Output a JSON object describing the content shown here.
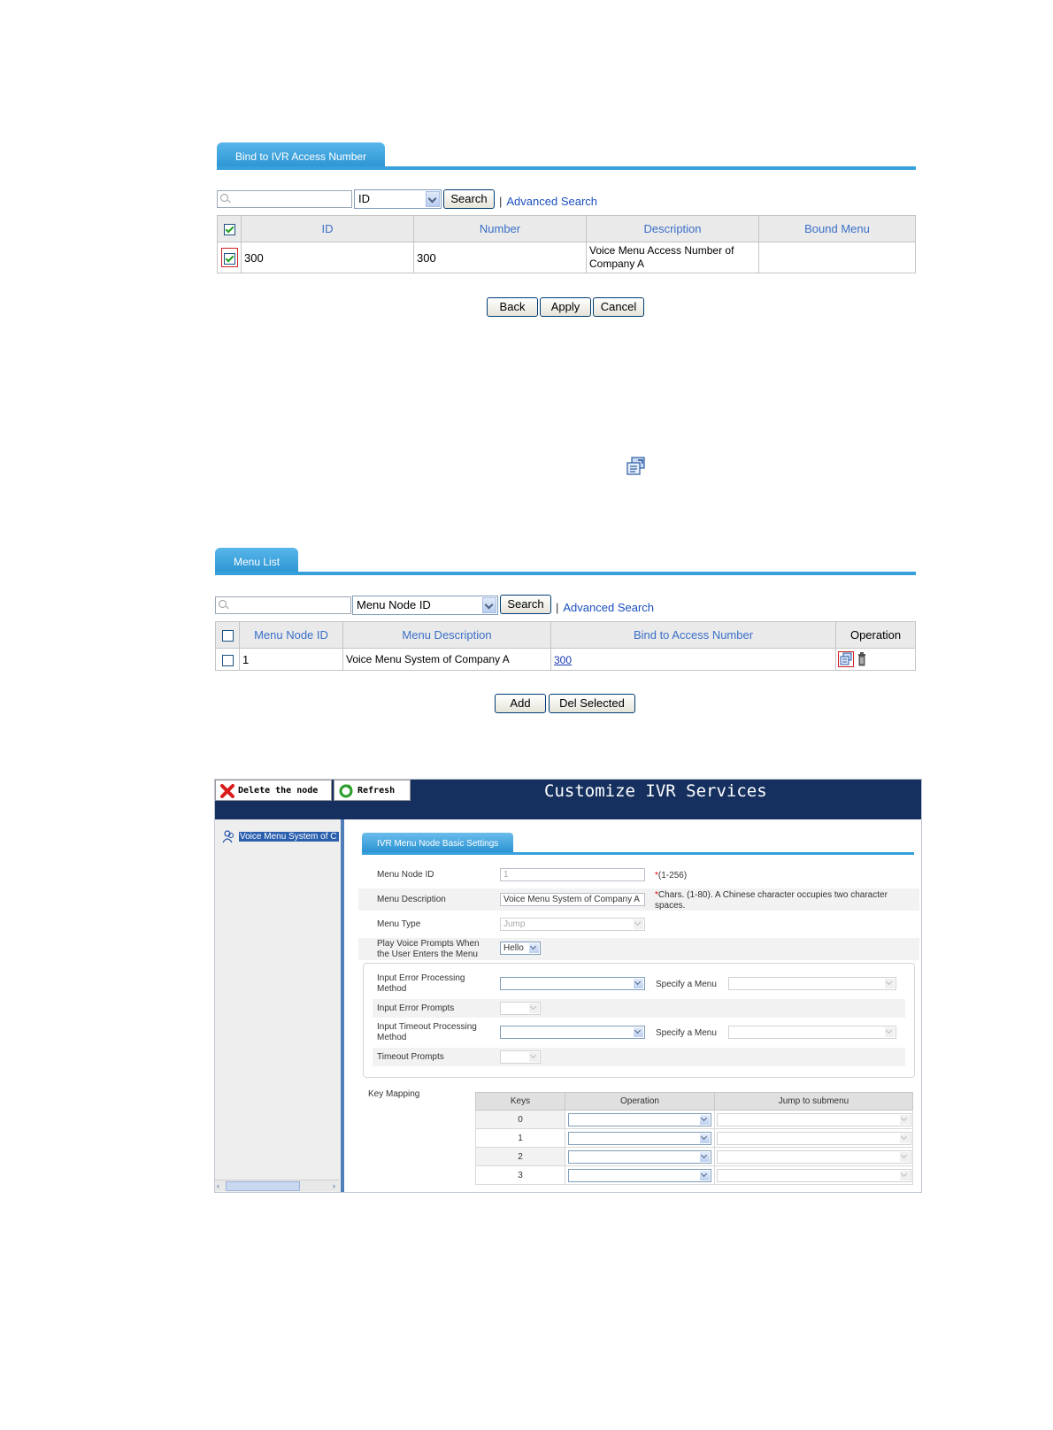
{
  "panel1": {
    "tab": "Bind to IVR Access Number",
    "search": {
      "value": "",
      "field": "ID",
      "button": "Search",
      "advanced": "Advanced Search"
    },
    "columns": [
      "ID",
      "Number",
      "Description",
      "Bound Menu"
    ],
    "rows": [
      {
        "checked": true,
        "id": "300",
        "number": "300",
        "description": "Voice Menu Access Number of Company A",
        "bound_menu": ""
      }
    ],
    "buttons": {
      "back": "Back",
      "apply": "Apply",
      "cancel": "Cancel"
    }
  },
  "icon_standalone": "bind-access-number-icon",
  "panel2": {
    "tab": "Menu List",
    "search": {
      "value": "",
      "field": "Menu Node ID",
      "button": "Search",
      "advanced": "Advanced Search"
    },
    "columns": [
      "Menu Node ID",
      "Menu Description",
      "Bind to Access Number",
      "Operation"
    ],
    "rows": [
      {
        "checked": false,
        "node_id": "1",
        "description": "Voice Menu System of Company A",
        "access_number": "300"
      }
    ],
    "buttons": {
      "add": "Add",
      "del_selected": "Del Selected"
    }
  },
  "ivr": {
    "toolbar": {
      "delete": "Delete the node",
      "refresh": "Refresh"
    },
    "title": "Customize IVR Services",
    "tree_item": "Voice Menu System of C",
    "section_tab": "IVR Menu Node Basic Settings",
    "fields": {
      "menu_node_id": {
        "label": "Menu Node ID",
        "value": "1",
        "note": "(1-256)"
      },
      "menu_description": {
        "label": "Menu Description",
        "value": "Voice Menu System of Company A",
        "note": "Chars. (1-80). A Chinese character occupies two character spaces."
      },
      "menu_type": {
        "label": "Menu Type",
        "value": "Jump"
      },
      "play_prompts": {
        "label": "Play Voice Prompts When the User Enters the Menu",
        "value": "Hello"
      },
      "input_error_method": {
        "label": "Input Error Processing Method",
        "value": "",
        "specify_label": "Specify a Menu",
        "specify_value": ""
      },
      "input_error_prompts": {
        "label": "Input Error Prompts",
        "value": ""
      },
      "input_timeout_method": {
        "label": "Input Timeout Processing Method",
        "value": "",
        "specify_label": "Specify a Menu",
        "specify_value": ""
      },
      "timeout_prompts": {
        "label": "Timeout Prompts",
        "value": ""
      }
    },
    "key_mapping": {
      "label": "Key Mapping",
      "columns": [
        "Keys",
        "Operation",
        "Jump to submenu"
      ],
      "keys": [
        "0",
        "1",
        "2",
        "3"
      ]
    }
  }
}
